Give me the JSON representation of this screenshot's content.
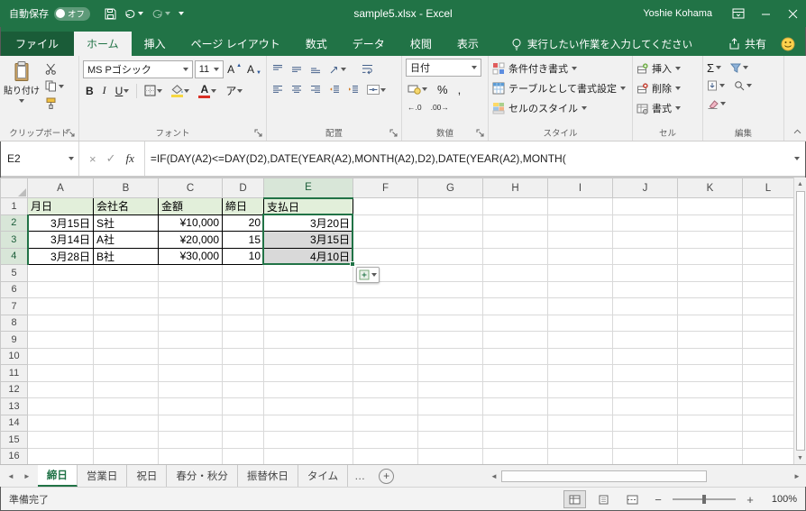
{
  "title_bar": {
    "autosave_label": "自動保存",
    "autosave_state": "オフ",
    "doc_title": "sample5.xlsx - Excel",
    "user_name": "Yoshie Kohama"
  },
  "ribbon": {
    "file_tab": "ファイル",
    "tabs": [
      "ホーム",
      "挿入",
      "ページ レイアウト",
      "数式",
      "データ",
      "校閲",
      "表示"
    ],
    "active_tab": "ホーム",
    "tell_me": "実行したい作業を入力してください",
    "share_label": "共有",
    "clipboard": {
      "label": "クリップボード",
      "paste": "貼り付け"
    },
    "font": {
      "label": "フォント",
      "name": "MS Pゴシック",
      "size": "11",
      "size_letter": "A",
      "bold": "B",
      "italic": "I",
      "underline": "U",
      "color_letter": "A",
      "phonetic": "ア"
    },
    "alignment": {
      "label": "配置"
    },
    "number": {
      "label": "数値",
      "format": "日付",
      "percent": "%",
      "comma": ",",
      "increase_decimal": "←.0",
      "decrease_decimal": ".00→"
    },
    "styles": {
      "label": "スタイル",
      "items": [
        "条件付き書式",
        "テーブルとして書式設定",
        "セルのスタイル"
      ]
    },
    "cells": {
      "label": "セル",
      "items": [
        "挿入",
        "削除",
        "書式"
      ]
    },
    "editing": {
      "label": "編集",
      "autosum": "Σ"
    }
  },
  "formula_bar": {
    "name_box": "E2",
    "cancel": "×",
    "enter": "✓",
    "fx": "fx",
    "formula": "=IF(DAY(A2)<=DAY(D2),DATE(YEAR(A2),MONTH(A2),D2),DATE(YEAR(A2),MONTH("
  },
  "grid": {
    "columns": [
      "A",
      "B",
      "C",
      "D",
      "E",
      "F",
      "G",
      "H",
      "I",
      "J",
      "K",
      "L"
    ],
    "rows": 16,
    "selection": {
      "col": "E",
      "row_start": 2,
      "row_end": 4,
      "active_cell": "E2"
    },
    "cells": [
      {
        "r": 1,
        "c": "A",
        "v": "月日",
        "style": "header"
      },
      {
        "r": 1,
        "c": "B",
        "v": "会社名",
        "style": "header"
      },
      {
        "r": 1,
        "c": "C",
        "v": "金額",
        "style": "header"
      },
      {
        "r": 1,
        "c": "D",
        "v": "締日",
        "style": "header"
      },
      {
        "r": 1,
        "c": "E",
        "v": "支払日",
        "style": "header"
      },
      {
        "r": 2,
        "c": "A",
        "v": "3月15日",
        "align": "right"
      },
      {
        "r": 2,
        "c": "B",
        "v": "S社",
        "align": "left"
      },
      {
        "r": 2,
        "c": "C",
        "v": "¥10,000",
        "align": "right"
      },
      {
        "r": 2,
        "c": "D",
        "v": "20",
        "align": "right"
      },
      {
        "r": 2,
        "c": "E",
        "v": "3月20日",
        "align": "right"
      },
      {
        "r": 3,
        "c": "A",
        "v": "3月14日",
        "align": "right"
      },
      {
        "r": 3,
        "c": "B",
        "v": "A社",
        "align": "left"
      },
      {
        "r": 3,
        "c": "C",
        "v": "¥20,000",
        "align": "right"
      },
      {
        "r": 3,
        "c": "D",
        "v": "15",
        "align": "right"
      },
      {
        "r": 3,
        "c": "E",
        "v": "3月15日",
        "align": "right"
      },
      {
        "r": 4,
        "c": "A",
        "v": "3月28日",
        "align": "right"
      },
      {
        "r": 4,
        "c": "B",
        "v": "B社",
        "align": "left"
      },
      {
        "r": 4,
        "c": "C",
        "v": "¥30,000",
        "align": "right"
      },
      {
        "r": 4,
        "c": "D",
        "v": "10",
        "align": "right"
      },
      {
        "r": 4,
        "c": "E",
        "v": "4月10日",
        "align": "right"
      }
    ]
  },
  "sheet_bar": {
    "tabs": [
      "締日",
      "営業日",
      "祝日",
      "春分・秋分",
      "振替休日",
      "タイム"
    ],
    "active_tab": "締日",
    "overflow": "…",
    "add_sheet": "+"
  },
  "status_bar": {
    "mode": "準備完了",
    "zoom": "100%"
  },
  "colors": {
    "title_green": "#217346",
    "table_header_fill": "#E2EFDA",
    "selection_border": "#217346",
    "selection_fill": "#D9D9D9",
    "fill_color_swatch": "#F7D842",
    "font_color_swatch": "#D93025"
  }
}
